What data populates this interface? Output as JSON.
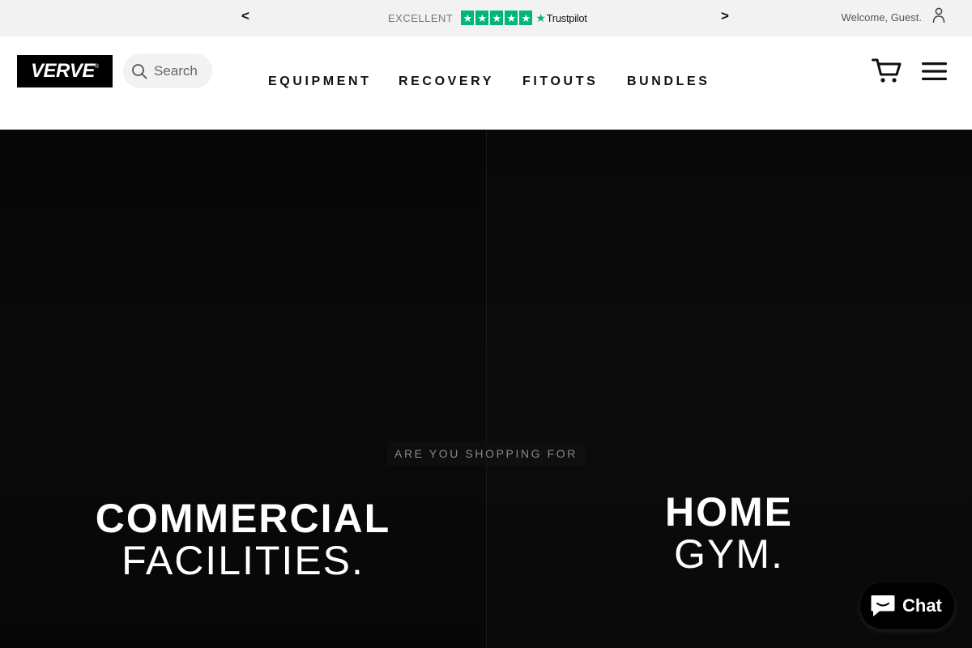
{
  "announcement": {
    "prev_label": "<",
    "next_label": ">",
    "rating_text": "EXCELLENT",
    "trustpilot_label": "Trustpilot",
    "star_color": "#00b67a",
    "welcome_text": "Welcome, Guest."
  },
  "header": {
    "logo_text": "VERVE",
    "logo_mark": "®",
    "search_placeholder": "Search",
    "nav": [
      {
        "label": "EQUIPMENT"
      },
      {
        "label": "RECOVERY"
      },
      {
        "label": "FITOUTS"
      },
      {
        "label": "BUNDLES"
      }
    ],
    "cart_icon": "cart-icon",
    "menu_icon": "hamburger-menu-icon"
  },
  "hero": {
    "question": "ARE YOU SHOPPING FOR",
    "commercial": {
      "line1": "COMMERCIAL",
      "line2": "FACILITIES."
    },
    "home": {
      "line1": "HOME",
      "line2": "GYM."
    }
  },
  "chat": {
    "label": "Chat",
    "icon": "chat-bubble-icon"
  }
}
